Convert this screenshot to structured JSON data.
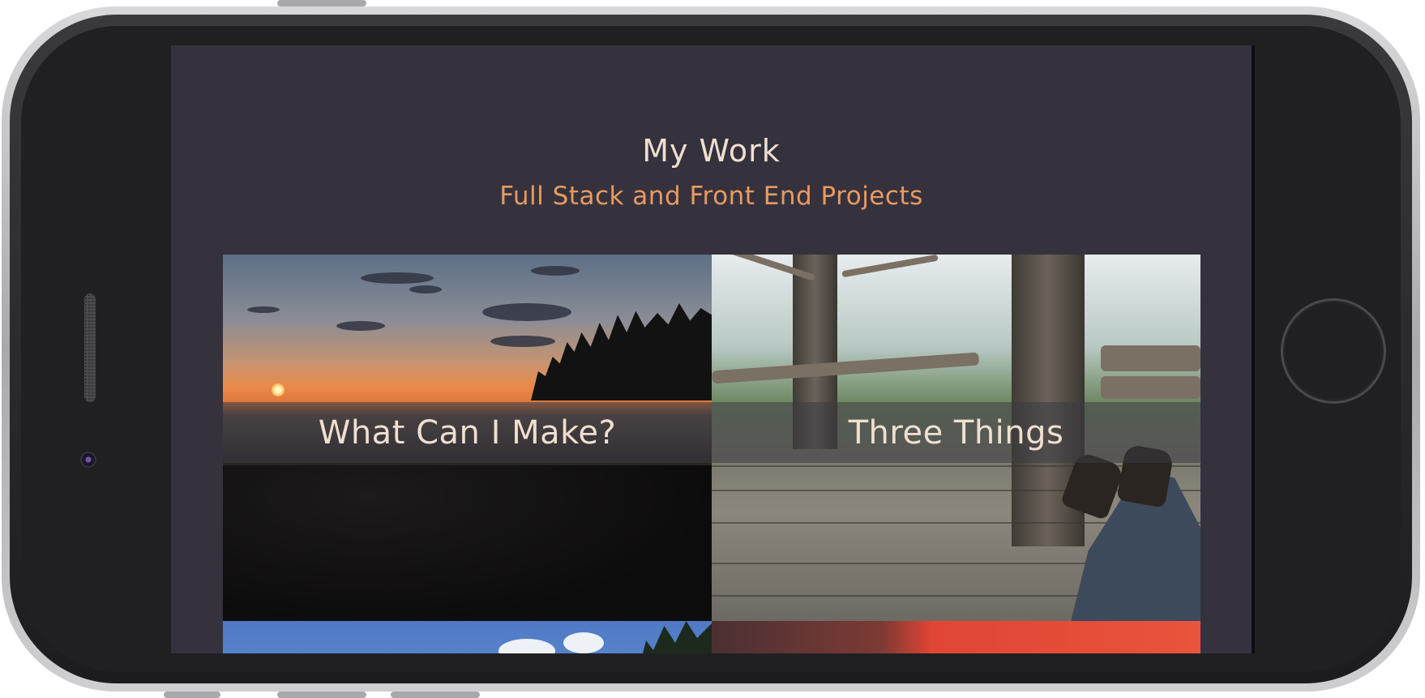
{
  "page": {
    "title": "My Work",
    "subtitle": "Full Stack and Front End Projects"
  },
  "projects": [
    {
      "title": "What Can I Make?",
      "image": "sunset-coastline"
    },
    {
      "title": "Three Things",
      "image": "treehouse-deck"
    },
    {
      "title": "",
      "image": "blue-sky-clouds"
    },
    {
      "title": "",
      "image": "red-interior"
    }
  ],
  "colors": {
    "background": "#35323e",
    "title": "#efdfcf",
    "accent": "#e99a5f"
  },
  "device": {
    "frame": "smartphone-landscape",
    "icons": [
      "home-button-icon",
      "front-camera-icon",
      "earpiece-speaker-icon"
    ]
  }
}
